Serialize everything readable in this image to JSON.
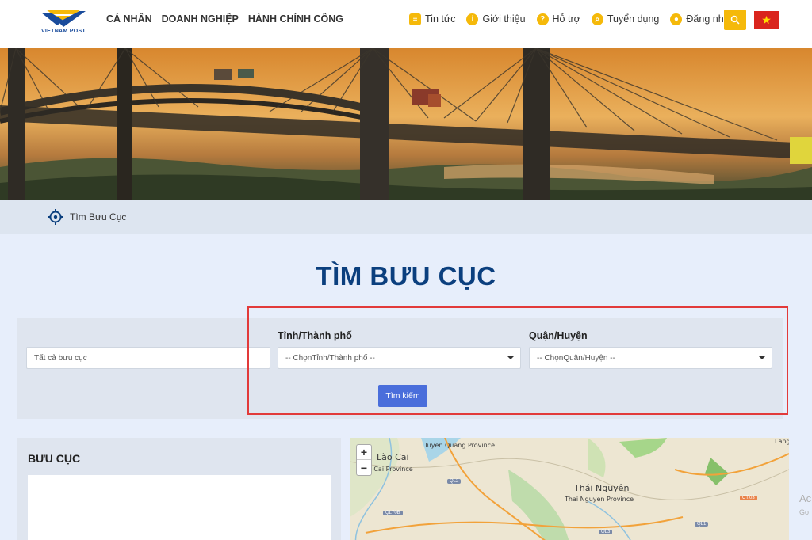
{
  "header": {
    "logo_text": "VIETNAM POST",
    "nav": [
      "CÁ NHÂN",
      "DOANH NGHIỆP",
      "HÀNH CHÍNH CÔNG"
    ],
    "links": [
      {
        "label": "Tin tức",
        "icon": "news-icon"
      },
      {
        "label": "Giới thiệu",
        "icon": "info-icon"
      },
      {
        "label": "Hỗ trợ",
        "icon": "help-icon"
      },
      {
        "label": "Tuyển dụng",
        "icon": "recruit-search-icon"
      },
      {
        "label": "Đăng nhập",
        "icon": "user-icon"
      }
    ],
    "search_icon": "search-icon",
    "flag_icon": "vietnam-flag-icon"
  },
  "breadcrumb": {
    "label": "Tìm Bưu Cục",
    "icon": "crosshair-icon"
  },
  "page_title": "TÌM BƯU CỤC",
  "search": {
    "keyword_placeholder": "Tất cả bưu cục",
    "province_label": "Tỉnh/Thành phố",
    "province_value": "-- ChọnTỉnh/Thành phố --",
    "district_label": "Quận/Huyện",
    "district_value": "-- ChọnQuận/Huyện --",
    "button": "Tìm kiếm"
  },
  "list": {
    "title": "BƯU CỤC"
  },
  "map": {
    "zoom_in": "+",
    "zoom_out": "−",
    "labels": [
      "Lào Cai",
      "ào Cai Province",
      "Tuyen Quang Province",
      "Thái Nguyên",
      "Thai Nguyen Province",
      "Lang"
    ],
    "roads": [
      "QL2",
      "QL70B",
      "QL3",
      "QL1",
      "CT.03"
    ]
  },
  "watermark": {
    "line1": "Ac",
    "line2": "Go"
  },
  "colors": {
    "brand_yellow": "#f5b90a",
    "title_blue": "#0b3f7e",
    "button_blue": "#4a6edb",
    "highlight_red": "#e23a3a"
  }
}
